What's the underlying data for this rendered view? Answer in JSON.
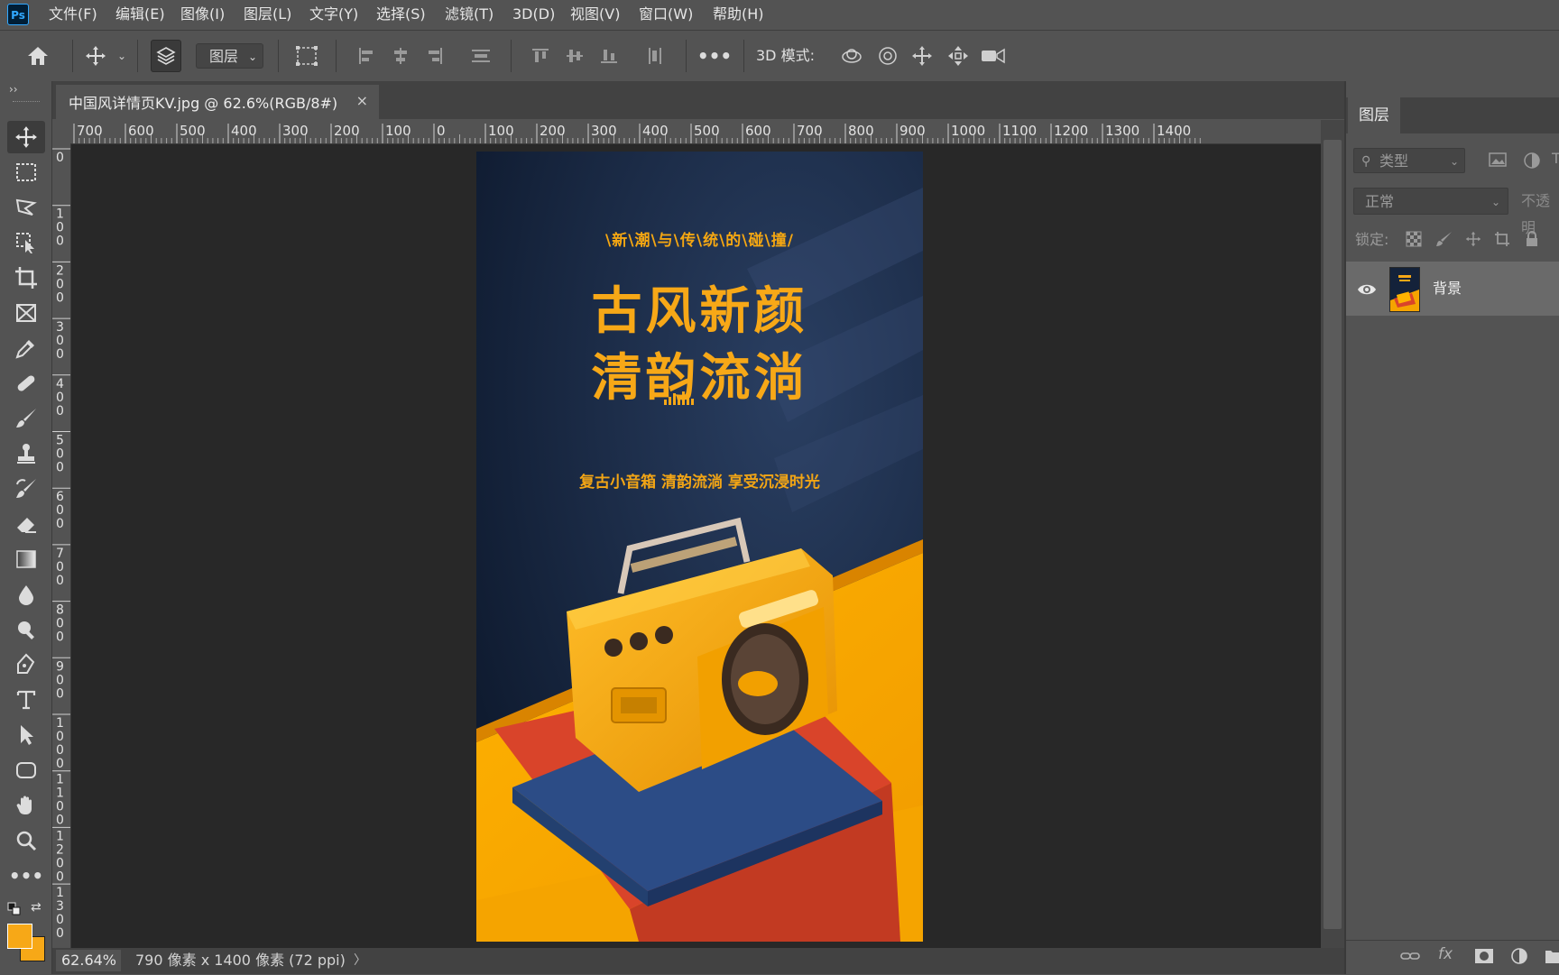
{
  "app": {
    "logo": "Ps"
  },
  "menu": [
    "文件(F)",
    "编辑(E)",
    "图像(I)",
    "图层(L)",
    "文字(Y)",
    "选择(S)",
    "滤镜(T)",
    "3D(D)",
    "视图(V)",
    "窗口(W)",
    "帮助(H)"
  ],
  "options_bar": {
    "auto_select_target": "图层",
    "mode_3d_label": "3D 模式:"
  },
  "document": {
    "tab_title": "中国风详情页KV.jpg @ 62.6%(RGB/8#)",
    "close_glyph": "×",
    "zoom": "62.64%",
    "info": "790 像素 x 1400 像素 (72 ppi)",
    "info_arrow": "〉"
  },
  "ruler": {
    "h_labels": [
      "700",
      "600",
      "500",
      "400",
      "300",
      "200",
      "100",
      "0",
      "100",
      "200",
      "300",
      "400",
      "500",
      "600",
      "700",
      "800",
      "900",
      "1000",
      "1100",
      "1200",
      "1300",
      "1400"
    ],
    "v_labels": [
      "0",
      "100",
      "200",
      "300",
      "400",
      "500",
      "600",
      "700",
      "800",
      "900",
      "1000",
      "1100",
      "1200",
      "1300"
    ]
  },
  "poster": {
    "arc_text": "\\新\\潮\\与\\传\\统\\的\\碰\\撞/",
    "title_line1": "古风新颜",
    "title_line2": "清韵流淌",
    "subtitle": "复古小音箱  清韵流淌  享受沉浸时光",
    "colors": {
      "bg": "#13213a",
      "accent": "#f7a817",
      "red": "#d9442a",
      "blue": "#2c4c86"
    }
  },
  "layers_panel": {
    "tab": "图层",
    "kind_filter": "类型",
    "blend_mode": "正常",
    "opacity_label": "不透明",
    "lock_label": "锁定:",
    "layers": [
      {
        "name": "背景",
        "visible": true
      }
    ],
    "bottom_fx": "fx"
  },
  "colors": {
    "foreground": "#f7a817",
    "background": "#f7a817"
  }
}
